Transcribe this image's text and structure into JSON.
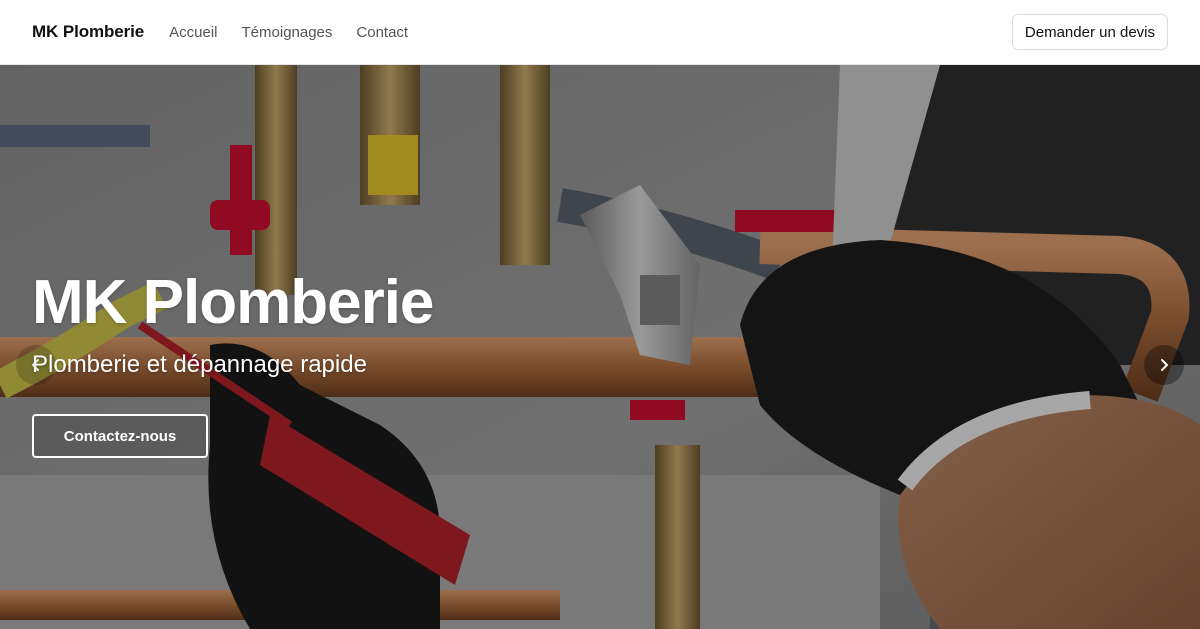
{
  "nav": {
    "brand": "MK Plomberie",
    "links": [
      "Accueil",
      "Témoignages",
      "Contact"
    ],
    "cta": "Demander un devis"
  },
  "hero": {
    "title": "MK Plomberie",
    "subtitle": "Plomberie et dépannage rapide",
    "cta": "Contactez-nous",
    "prev_icon": "chevron-left-icon",
    "next_icon": "chevron-right-icon"
  },
  "colors": {
    "nav_bg": "#ffffff",
    "hero_overlay": "#000000",
    "text_light": "#ffffff",
    "glove": "#1a1a1a",
    "valve_red": "#c8102e",
    "copper": "#b87333"
  }
}
